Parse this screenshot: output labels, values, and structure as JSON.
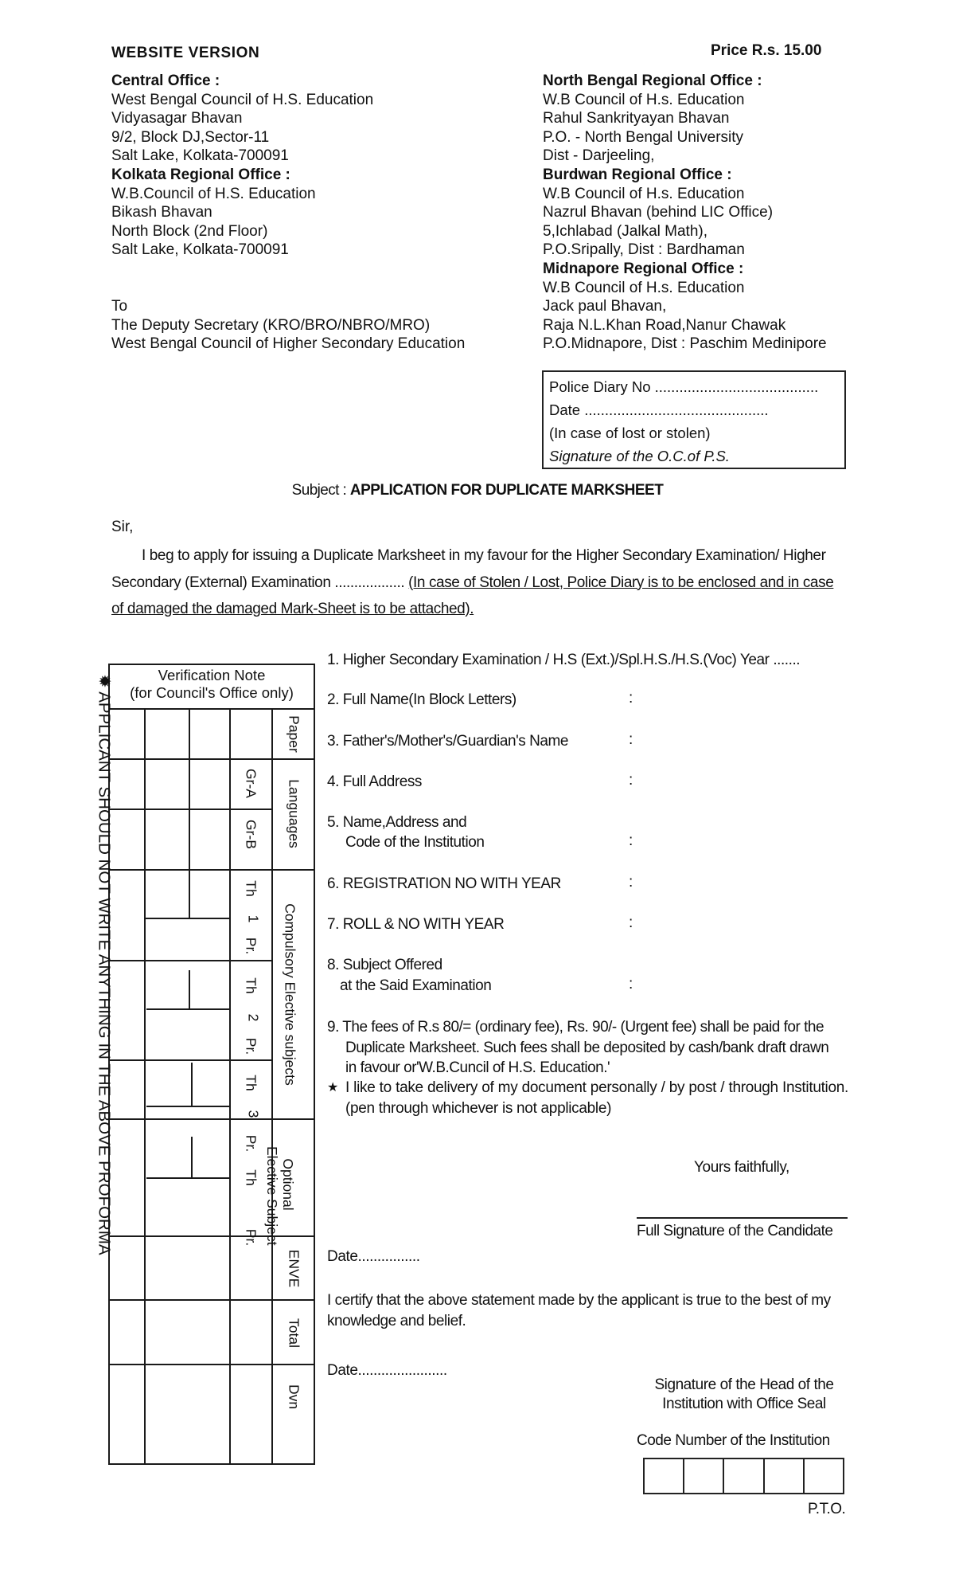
{
  "header": {
    "version_label": "WEBSITE  VERSION",
    "price": "Price R.s. 15.00"
  },
  "offices_left": [
    {
      "text": "Central Office :",
      "bold": true
    },
    {
      "text": "West Bengal Council of H.S. Education",
      "bold": false
    },
    {
      "text": "Vidyasagar Bhavan",
      "bold": false
    },
    {
      "text": "9/2, Block DJ,Sector-11",
      "bold": false
    },
    {
      "text": "Salt Lake, Kolkata-700091",
      "bold": false
    },
    {
      "text": "Kolkata Regional Office :",
      "bold": true
    },
    {
      "text": "W.B.Council of H.S. Education",
      "bold": false
    },
    {
      "text": "Bikash Bhavan",
      "bold": false
    },
    {
      "text": "North Block (2nd Floor)",
      "bold": false
    },
    {
      "text": "Salt Lake, Kolkata-700091",
      "bold": false
    }
  ],
  "offices_right": [
    {
      "text": "North Bengal Regional Office :",
      "bold": true
    },
    {
      "text": "W.B Council of H.s. Education",
      "bold": false
    },
    {
      "text": "Rahul Sankrityayan Bhavan",
      "bold": false
    },
    {
      "text": "P.O. - North Bengal University",
      "bold": false
    },
    {
      "text": "Dist - Darjeeling,",
      "bold": false
    },
    {
      "text": "Burdwan Regional Office :",
      "bold": true
    },
    {
      "text": "W.B Council of H.s. Education",
      "bold": false
    },
    {
      "text": "Nazrul Bhavan (behind LIC Office)",
      "bold": false
    },
    {
      "text": "5,Ichlabad (Jalkal Math),",
      "bold": false
    },
    {
      "text": "P.O.Sripally, Dist : Bardhaman",
      "bold": false
    },
    {
      "text": "Midnapore Regional Office :",
      "bold": true
    },
    {
      "text": "W.B Council of H.s. Education",
      "bold": false
    },
    {
      "text": "Jack paul Bhavan,",
      "bold": false
    },
    {
      "text": "Raja N.L.Khan Road,Nanur Chawak",
      "bold": false
    },
    {
      "text": "P.O.Midnapore, Dist : Paschim Medinipore",
      "bold": false
    }
  ],
  "to_block": {
    "to": "To",
    "line1": "The Deputy Secretary (KRO/BRO/NBRO/MRO)",
    "line2": "West Bengal Council of Higher Secondary Education"
  },
  "police_box": {
    "diary_label": "Police Diary No ........................................",
    "date_label": "Date .............................................",
    "note": "(In case of lost or stolen)",
    "signature": "Signature of the O.C.of P.S."
  },
  "subject": {
    "label": "Subject : ",
    "value": "APPLICATION FOR DUPLICATE MARKSHEET"
  },
  "letter": {
    "salutation": "Sir,",
    "body_plain": "I beg to apply for issuing a Duplicate Marksheet in my favour for the Higher Secondary Examination/ Higher Secondary (External) Examination .................. ",
    "body_underlined": "(In case of Stolen / Lost, Police Diary is to be enclosed and in case of damaged the damaged Mark-Sheet is to be attached)."
  },
  "verification_table": {
    "title_line1": "Verification Note",
    "title_line2": "(for Council's Office only)",
    "labels": {
      "paper": "Paper",
      "languages": "Languages",
      "gr_a": "Gr-A",
      "gr_b": "Gr-B",
      "compulsory": "Compulsory  Elective  subjects",
      "optional_1": "Optional",
      "optional_2": "Elective Subject",
      "th": "Th",
      "pr": "Pr.",
      "n1": "1",
      "n2": "2",
      "n3": "3",
      "enve": "ENVE",
      "total": "Total",
      "dvn": "Dvn"
    }
  },
  "side_note": "✹ APPLICANT SHOULD NOT WRITE ANYTHING IN THE ABOVE PROFORMA",
  "form_items": [
    {
      "label": "1. Higher Secondary Examination / H.S (Ext.)/Spl.H.S./H.S.(Voc) Year .......",
      "colon": ""
    },
    {
      "label": "2. Full Name(In Block Letters)",
      "colon": ":"
    },
    {
      "label": "3. Father's/Mother's/Guardian's Name",
      "colon": ":"
    },
    {
      "label": "4. Full Address",
      "colon": ":"
    },
    {
      "label": "5. Name,Address and",
      "label2": "Code of the Institution",
      "colon": ":"
    },
    {
      "label": "6. REGISTRATION NO WITH YEAR",
      "colon": ":"
    },
    {
      "label": "7. ROLL & NO WITH YEAR",
      "colon": ":"
    },
    {
      "label": "8. Subject Offered",
      "label2": "at the Said Examination",
      "colon": ":"
    }
  ],
  "fees": {
    "line1": "9. The fees of R.s 80/= (ordinary fee), Rs. 90/- (Urgent fee) shall be paid for the",
    "line2": "Duplicate Marksheet. Such fees shall be deposited by cash/bank draft drawn",
    "line3": "in favour or'W.B.Cuncil of H.S. Education.'"
  },
  "delivery": {
    "star": "★",
    "text": "I like to take delivery of my document personally / by post / through Institution. (pen through whichever is not applicable)"
  },
  "closing": {
    "yours": "Yours faithfully,",
    "candidate_signature": "Full Signature of the Candidate",
    "date1": "Date................",
    "certify": "I certify that the above statement made by the applicant is true to the best of my knowledge and belief.",
    "date2": "Date.......................",
    "head_signature_1": "Signature of the Head of the",
    "head_signature_2": "Institution with Office Seal",
    "code_label": "Code Number of the Institution",
    "code_boxes": 5,
    "pto": "P.T.O."
  }
}
